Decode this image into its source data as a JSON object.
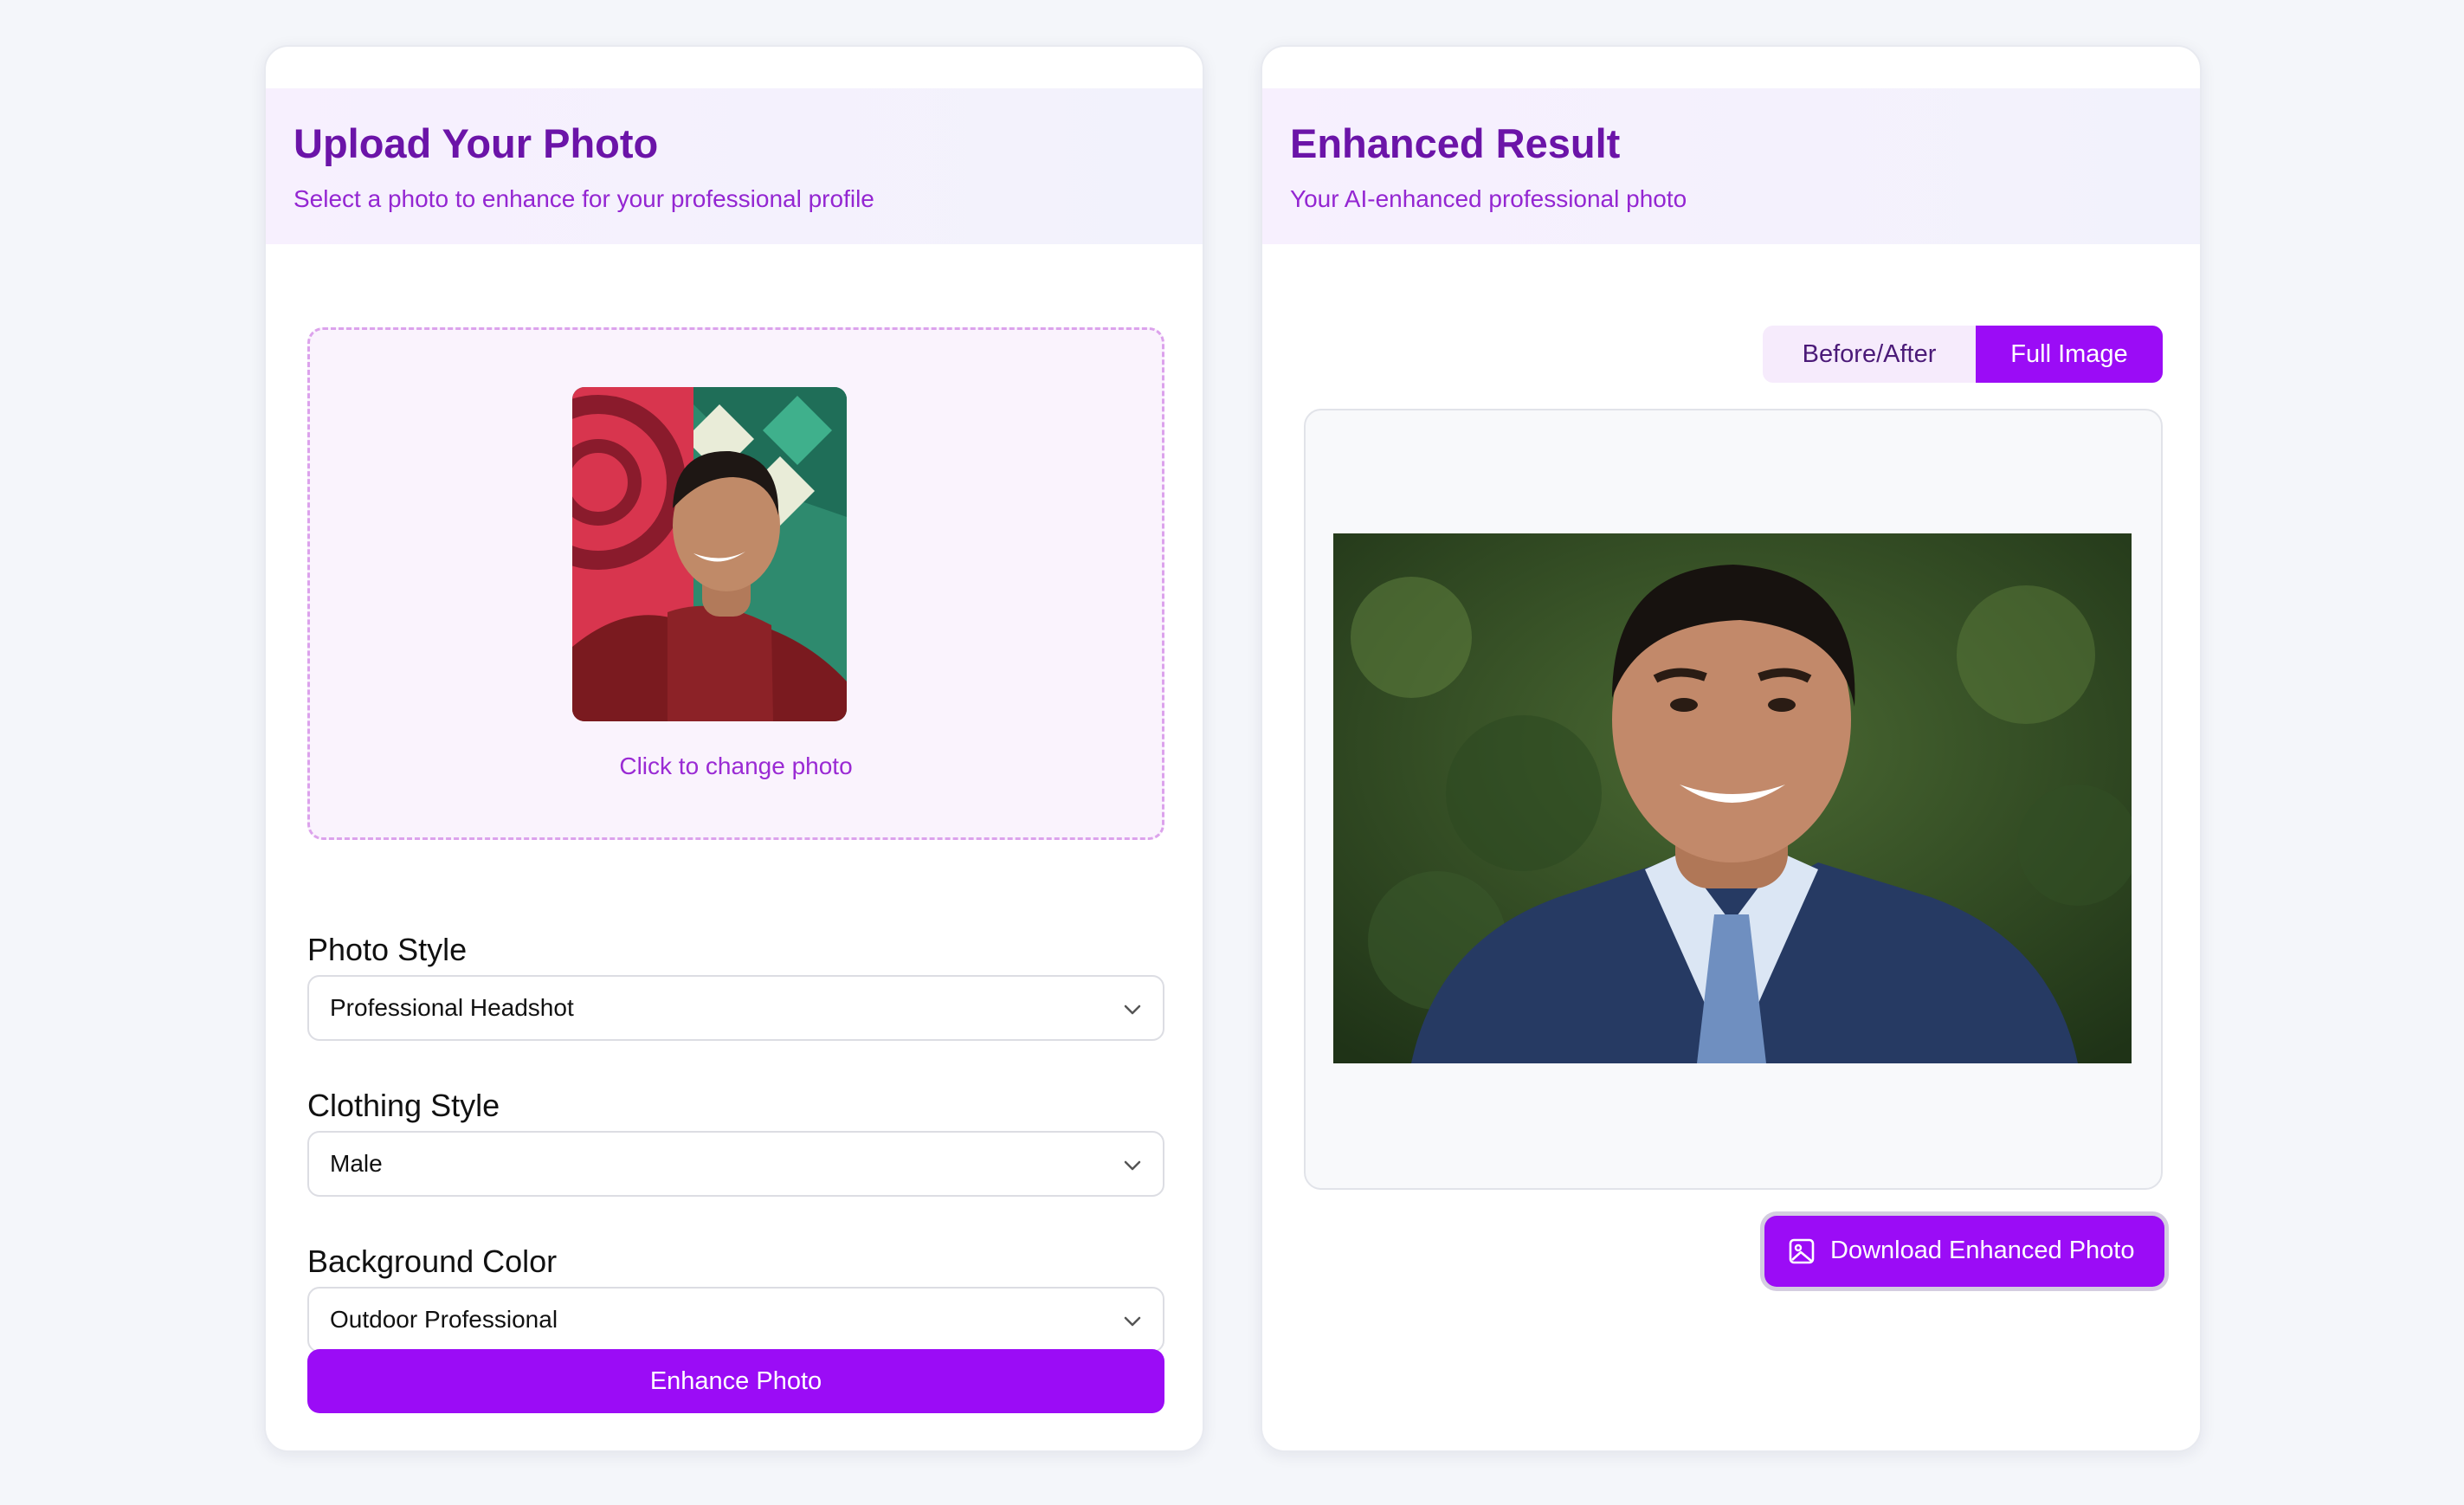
{
  "upload_panel": {
    "title": "Upload Your Photo",
    "subtitle": "Select a photo to enhance for your professional profile",
    "dropzone_hint": "Click to change photo",
    "fields": [
      {
        "label": "Photo Style",
        "value": "Professional Headshot"
      },
      {
        "label": "Clothing Style",
        "value": "Male"
      },
      {
        "label": "Background Color",
        "value": "Outdoor Professional"
      }
    ],
    "submit_label": "Enhance Photo"
  },
  "result_panel": {
    "title": "Enhanced Result",
    "subtitle": "Your AI-enhanced professional photo",
    "view_toggle": {
      "options": [
        "Before/After",
        "Full Image"
      ],
      "selected": "Full Image"
    },
    "download_label": "Download Enhanced Photo"
  },
  "icons": {
    "select_arrow": "chevron-down-icon",
    "download": "image-icon"
  },
  "colors": {
    "accent": "#9b0cf6",
    "title": "#6b14a8",
    "subtitle": "#9426d2",
    "dropzone_border": "#dca2ec",
    "dropzone_bg": "#faf3fd",
    "toggle_bg": "#f6ebfc"
  }
}
